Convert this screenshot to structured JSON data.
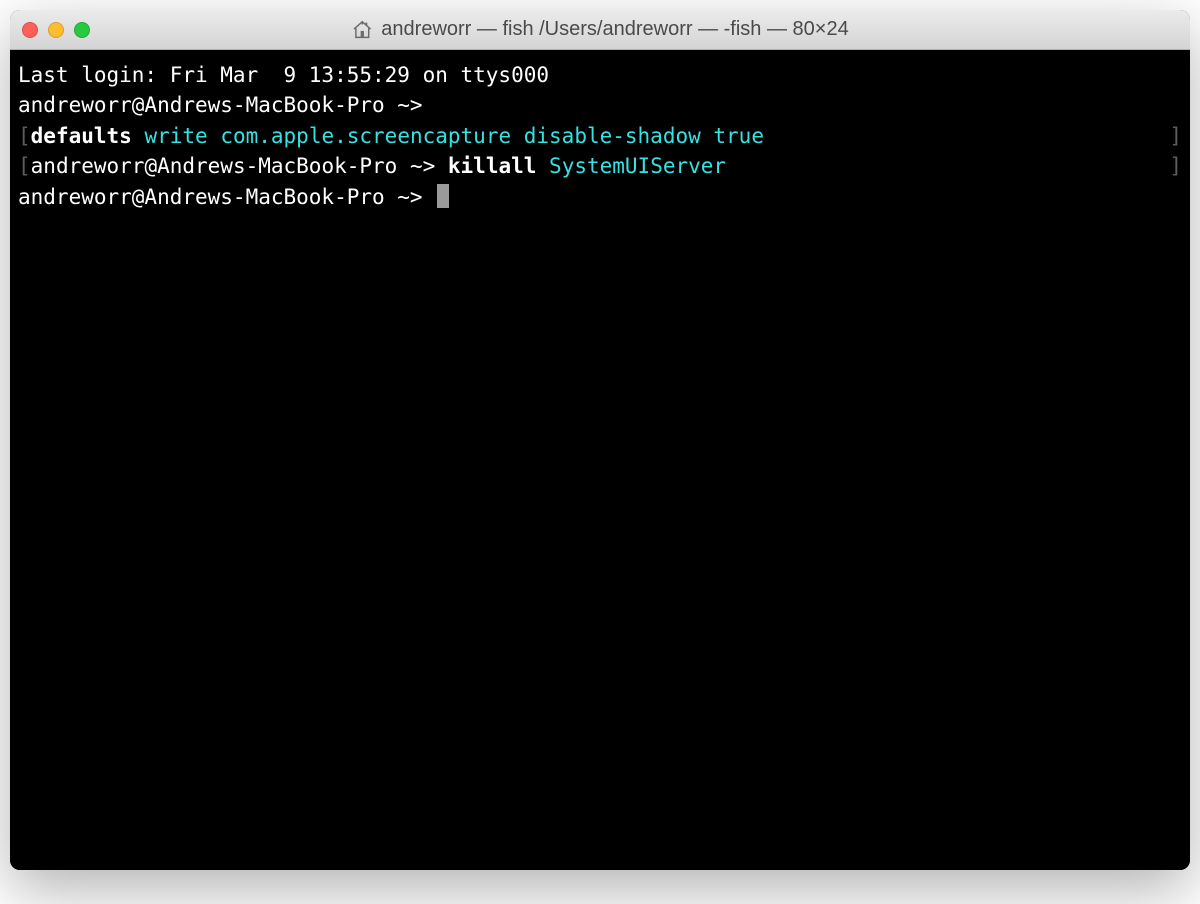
{
  "window": {
    "title": "andreworr — fish  /Users/andreworr — -fish — 80×24"
  },
  "terminal": {
    "last_login": "Last login: Fri Mar  9 13:55:29 on ttys000",
    "prompt": "andreworr@Andrews-MacBook-Pro ~>",
    "line2_left": {
      "open_bracket": "[",
      "cmd": "defaults",
      "args": " write com.apple.screencapture disable-shadow true"
    },
    "line2_right": "]",
    "line3_left": {
      "open_bracket": "[",
      "prompt": "andreworr@Andrews-MacBook-Pro ~> ",
      "cmd": "killall",
      "args": " SystemUIServer"
    },
    "line3_right": "]",
    "line4_prompt": "andreworr@Andrews-MacBook-Pro ~> "
  }
}
